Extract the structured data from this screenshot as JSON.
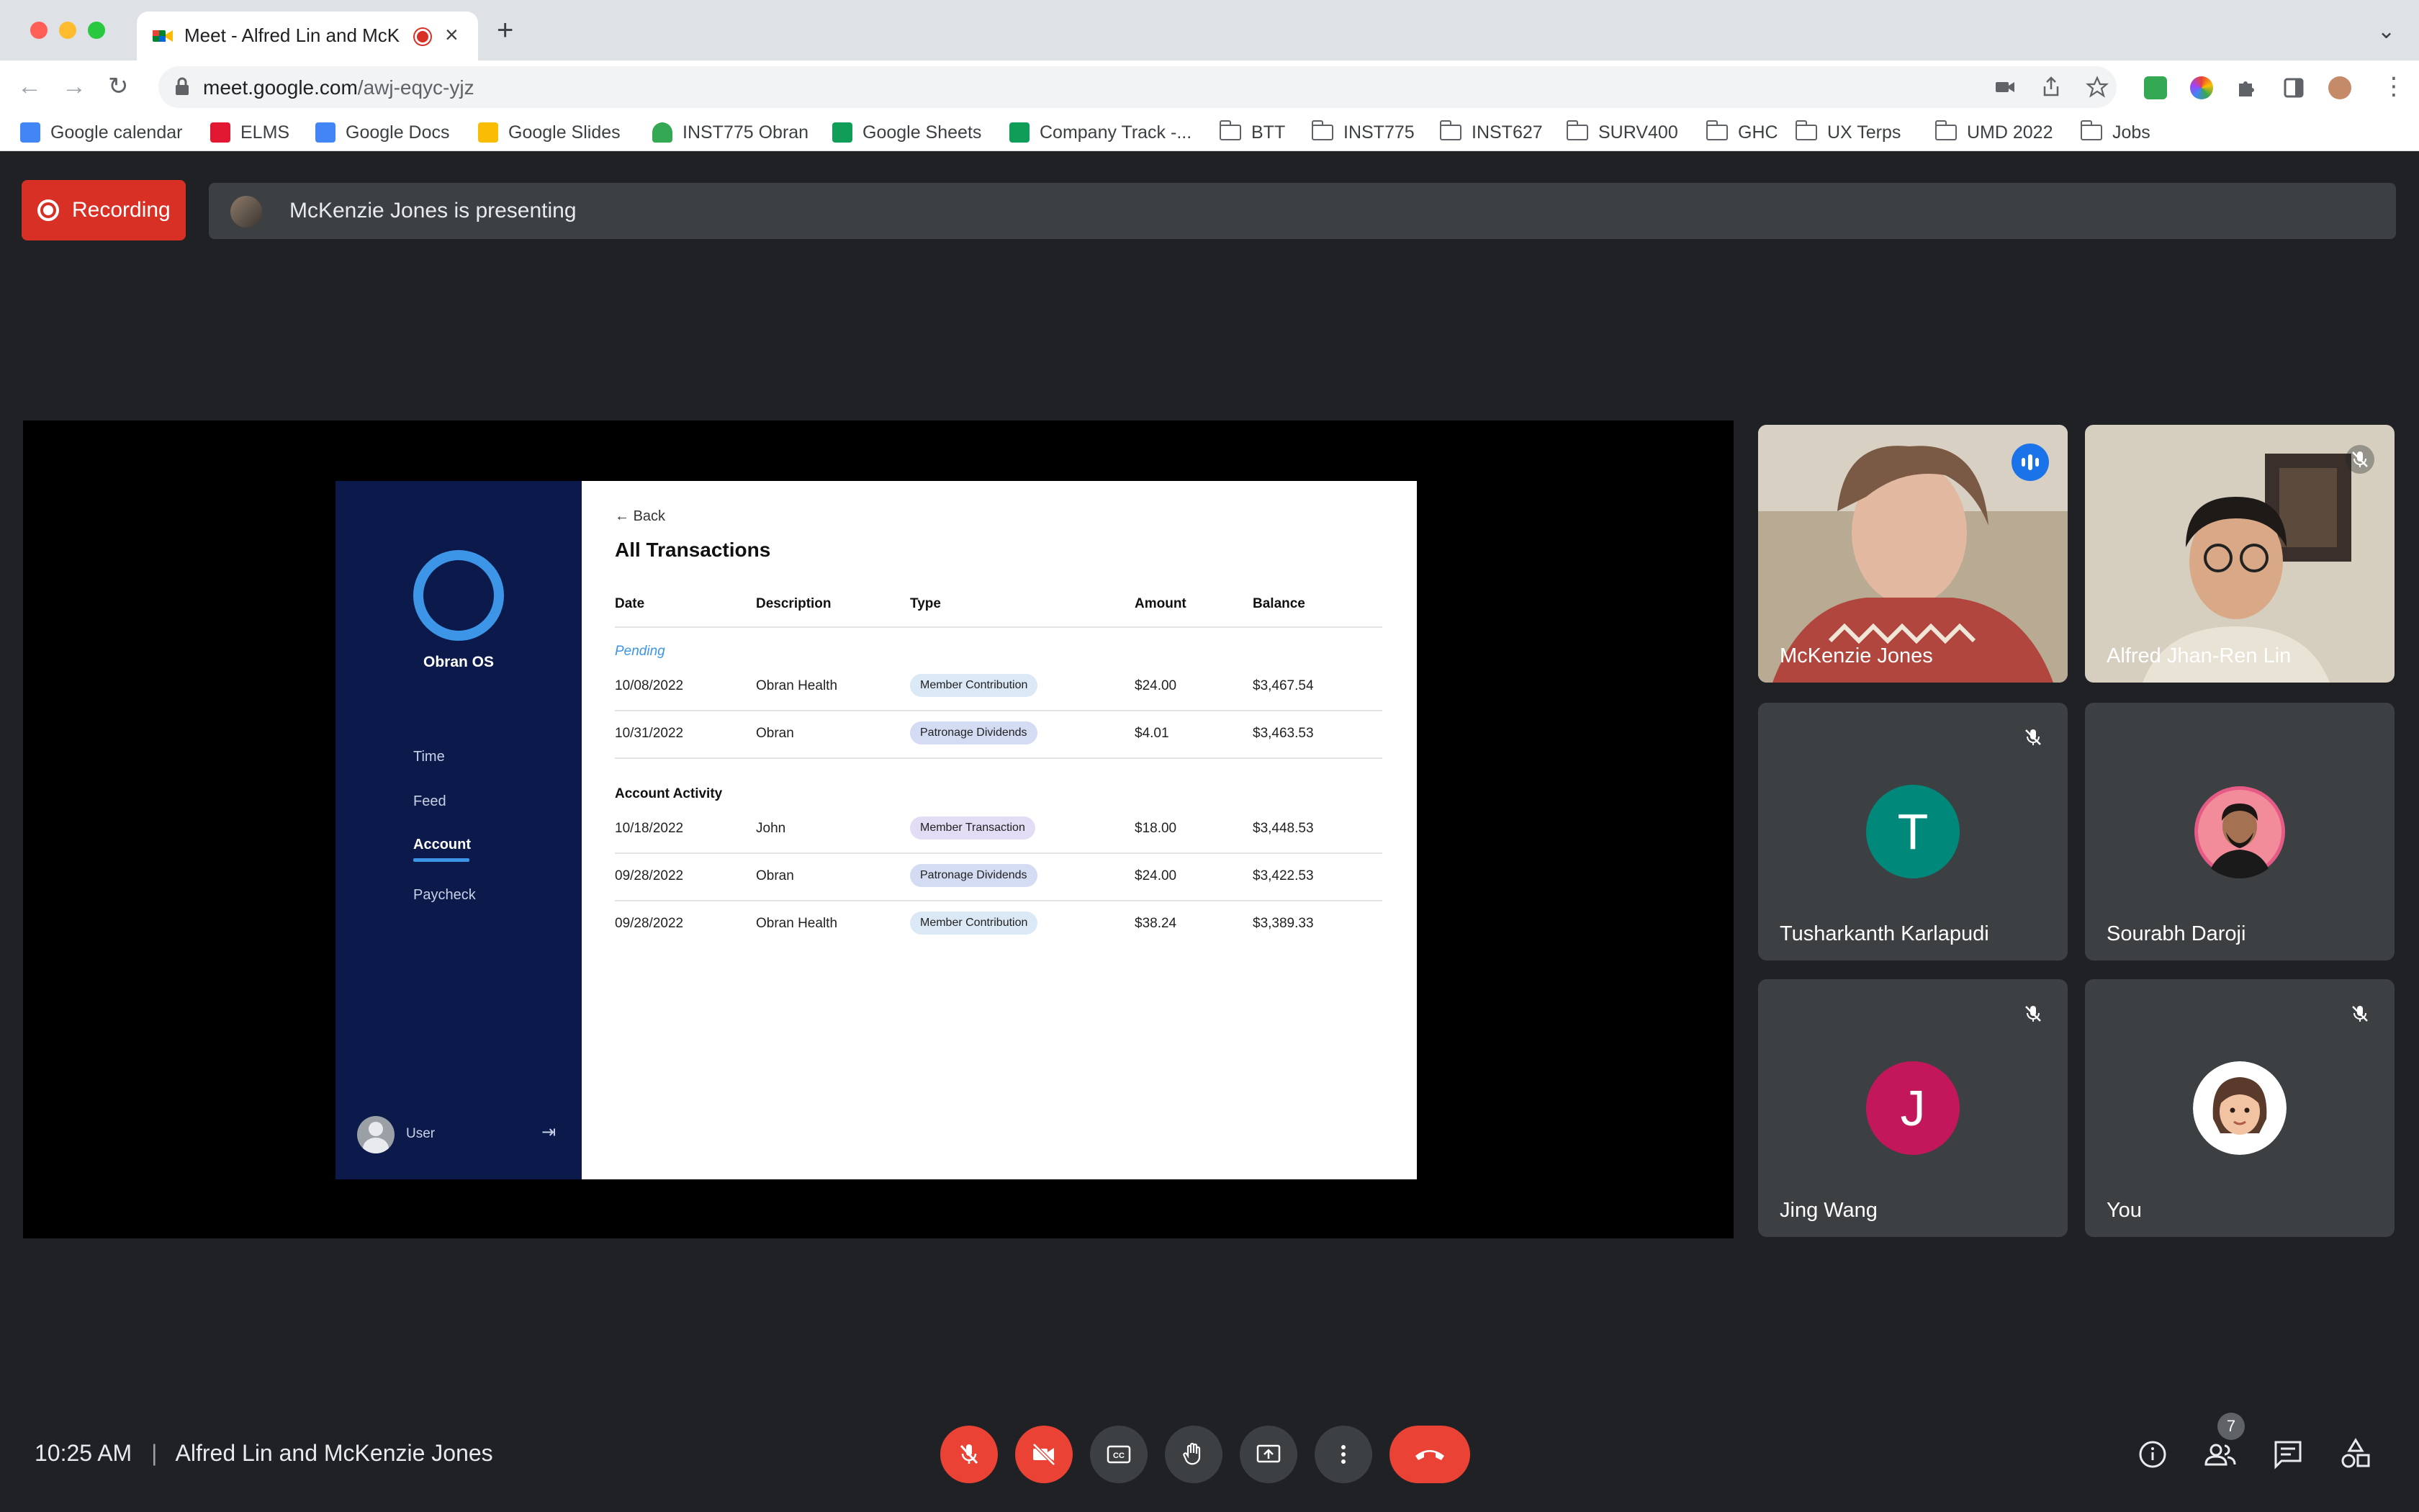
{
  "browser": {
    "tab_title": "Meet - Alfred Lin and McKenzie Jones",
    "url_host": "meet.google.com",
    "url_path": "/awj-eqyc-yjz",
    "bookmarks": [
      {
        "label": "Google calendar",
        "icon": "calendar-icon"
      },
      {
        "label": "ELMS",
        "icon": "elms-icon"
      },
      {
        "label": "Google Docs",
        "icon": "docs-icon"
      },
      {
        "label": "Google Slides",
        "icon": "slides-icon"
      },
      {
        "label": "INST775 Obran",
        "icon": "drive-icon"
      },
      {
        "label": "Google Sheets",
        "icon": "sheets-icon"
      },
      {
        "label": "Company Track -...",
        "icon": "sheets-icon"
      },
      {
        "label": "BTT",
        "icon": "folder-icon"
      },
      {
        "label": "INST775",
        "icon": "folder-icon"
      },
      {
        "label": "INST627",
        "icon": "folder-icon"
      },
      {
        "label": "SURV400",
        "icon": "folder-icon"
      },
      {
        "label": "GHC",
        "icon": "folder-icon"
      },
      {
        "label": "UX Terps",
        "icon": "folder-icon"
      },
      {
        "label": "UMD 2022",
        "icon": "folder-icon"
      },
      {
        "label": "Jobs",
        "icon": "folder-icon"
      }
    ]
  },
  "meet": {
    "recording_label": "Recording",
    "presenting_text": "McKenzie Jones is presenting",
    "time": "10:25 AM",
    "separator": "|",
    "meeting_title": "Alfred Lin and McKenzie Jones",
    "participant_count": "7",
    "participants": [
      {
        "name": "McKenzie Jones",
        "type": "video",
        "speaking": true
      },
      {
        "name": "Alfred Jhan-Ren Lin",
        "type": "video",
        "muted": true
      },
      {
        "name": "Tusharkanth Karlapudi",
        "initial": "T",
        "color": "#00897b",
        "muted": true
      },
      {
        "name": "Sourabh Daroji",
        "type": "photo",
        "muted": false
      },
      {
        "name": "Jing Wang",
        "initial": "J",
        "color": "#c2185b",
        "muted": true
      },
      {
        "name": "You",
        "type": "memoji",
        "muted": true
      }
    ]
  },
  "slide": {
    "app_name": "Obran OS",
    "nav": [
      "Time",
      "Feed",
      "Account",
      "Paycheck"
    ],
    "active_nav": "Account",
    "user_label": "User",
    "back_label": "Back",
    "page_title": "All Transactions",
    "columns": [
      "Date",
      "Description",
      "Type",
      "Amount",
      "Balance"
    ],
    "pending_label": "Pending",
    "activity_label": "Account Activity",
    "pending_rows": [
      {
        "date": "10/08/2022",
        "description": "Obran Health",
        "type": "Member Contribution",
        "amount": "$24.00",
        "balance": "$3,467.54"
      },
      {
        "date": "10/31/2022",
        "description": "Obran",
        "type": "Patronage Dividends",
        "amount": "$4.01",
        "balance": "$3,463.53"
      }
    ],
    "activity_rows": [
      {
        "date": "10/18/2022",
        "description": "John",
        "type": "Member Transaction",
        "amount": "$18.00",
        "balance": "$3,448.53"
      },
      {
        "date": "09/28/2022",
        "description": "Obran",
        "type": "Patronage Dividends",
        "amount": "$24.00",
        "balance": "$3,422.53"
      },
      {
        "date": "09/28/2022",
        "description": "Obran Health",
        "type": "Member Contribution",
        "amount": "$38.24",
        "balance": "$3,389.33"
      }
    ],
    "chip_colors": {
      "Member Contribution": "#dbe9f7",
      "Patronage Dividends": "#d3dcf3",
      "Member Transaction": "#e3dcf5"
    }
  }
}
